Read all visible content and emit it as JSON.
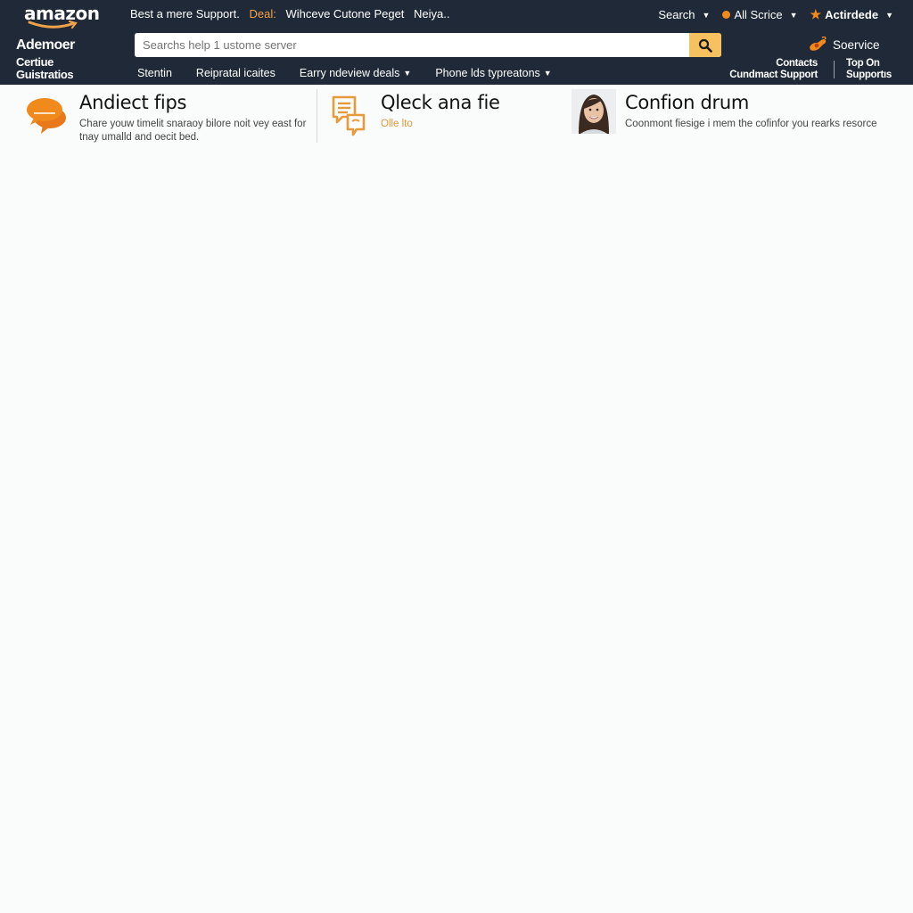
{
  "header": {
    "logo_text": "amazon",
    "top_links": [
      {
        "label": "Best a mere Support.",
        "accent": false
      },
      {
        "label": "Deal:",
        "accent": true
      },
      {
        "label": "Wihceve Cutone Peget",
        "accent": false
      },
      {
        "label": "Neiya..",
        "accent": false
      }
    ],
    "top_right": {
      "search_label": "Search",
      "all_service_label": "All Scrice",
      "activity_label": "Actirdede"
    },
    "brand": {
      "line1": "Ademoer",
      "line2": "Certiue",
      "line3": "Guistratios"
    },
    "search": {
      "value": "",
      "placeholder": "Searchs help 1 ustome server"
    },
    "nav": [
      {
        "label": "Stentin",
        "has_dropdown": false
      },
      {
        "label": "Reipratal icaites",
        "has_dropdown": false
      },
      {
        "label": "Earry ndeview deals",
        "has_dropdown": true
      },
      {
        "label": "Phone lds typreatons",
        "has_dropdown": true
      }
    ],
    "service_label": "Soervice",
    "contacts": {
      "line1": "Contacts",
      "line2": "Cundmact Support"
    },
    "top_on": {
      "line1": "Top On",
      "line2": "Supportıs"
    }
  },
  "features": [
    {
      "title": "Andiect fips",
      "description": "Chare youw timelit snaraoy bilore noit vey east for tnay umalld and oecit bed.",
      "icon": "chat-bubbles-icon"
    },
    {
      "title": "Qleck ana fie",
      "description": "Olle lto",
      "icon": "message-doc-icon"
    },
    {
      "title": "Confion drum",
      "description": "Coonmont fiesige i mem the cofinfor you rearks resorce",
      "icon": "avatar"
    }
  ],
  "colors": {
    "header_bg": "#1f2937",
    "accent": "#f08a1c",
    "search_button": "#f7c15f",
    "page_bg": "#fafbfb"
  }
}
